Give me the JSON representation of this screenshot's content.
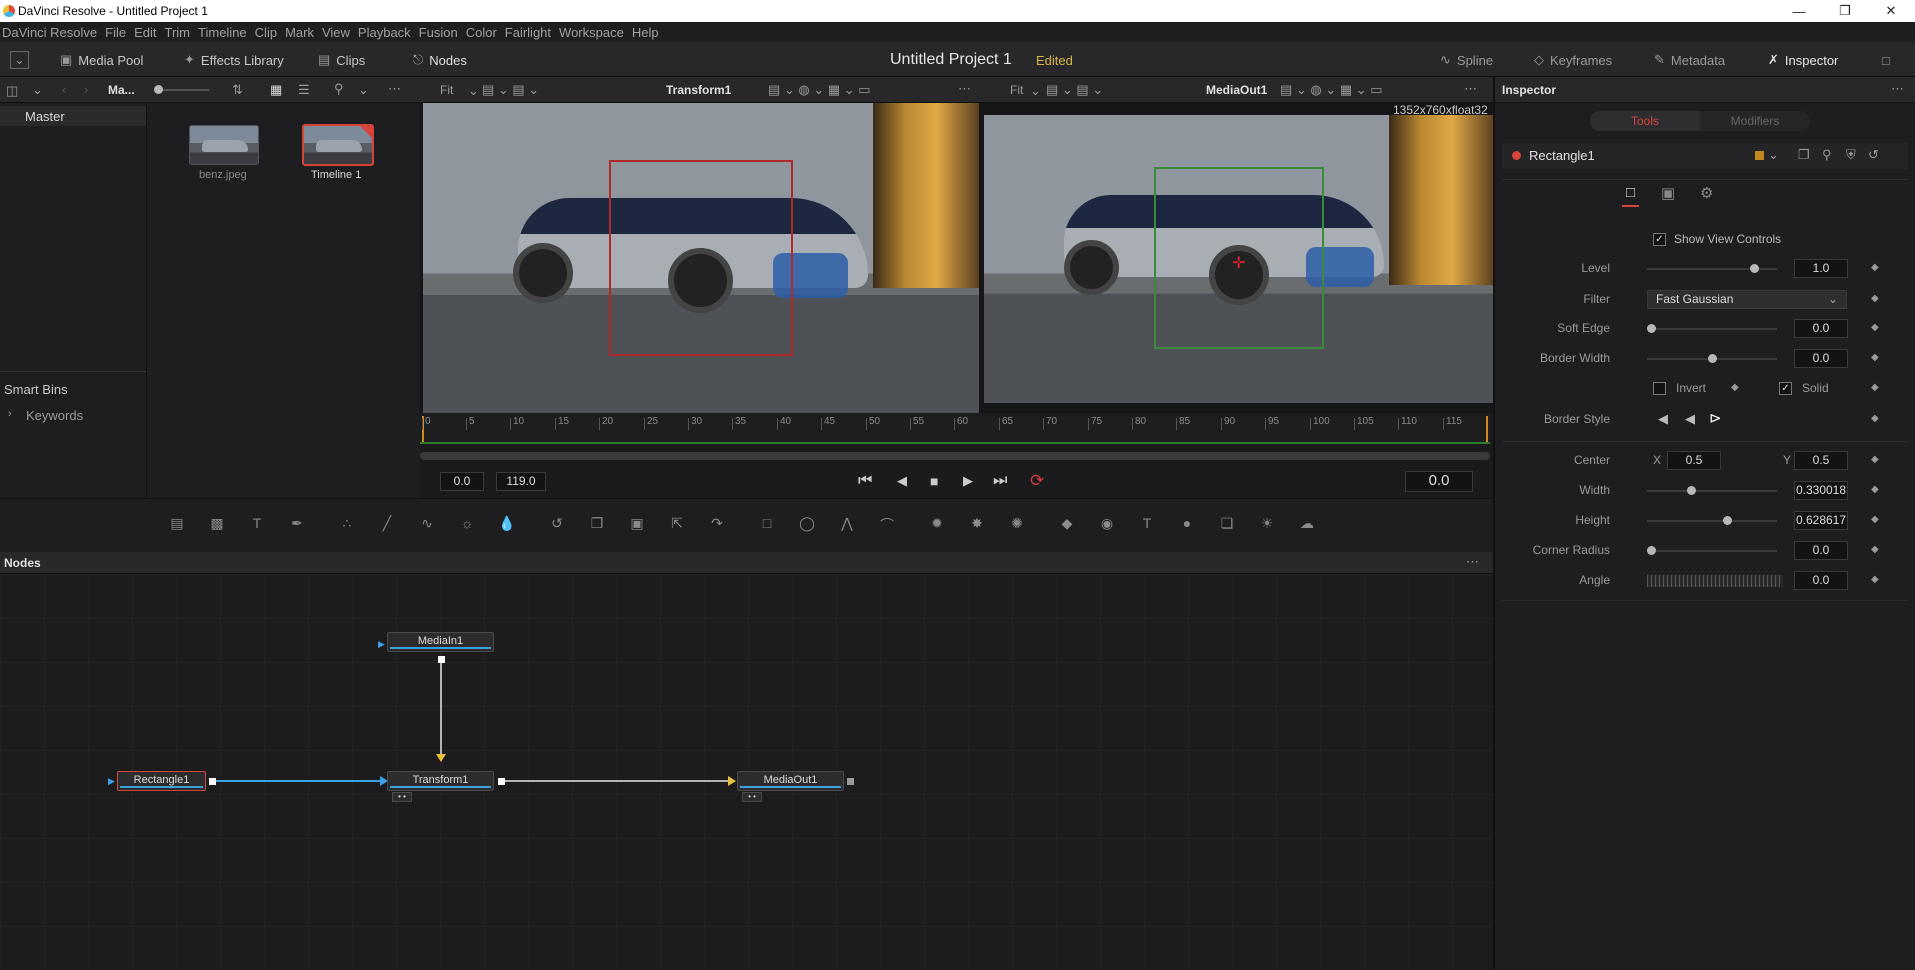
{
  "window": {
    "title": "DaVinci Resolve - Untitled Project 1"
  },
  "menu": [
    "DaVinci Resolve",
    "File",
    "Edit",
    "Trim",
    "Timeline",
    "Clip",
    "Mark",
    "View",
    "Playback",
    "Fusion",
    "Color",
    "Fairlight",
    "Workspace",
    "Help"
  ],
  "toolbar": {
    "media_pool": "Media Pool",
    "effects_library": "Effects Library",
    "clips": "Clips",
    "nodes": "Nodes",
    "project_title": "Untitled Project 1",
    "edited": "Edited",
    "spline": "Spline",
    "keyframes": "Keyframes",
    "metadata": "Metadata",
    "inspector": "Inspector"
  },
  "media_pool": {
    "bin_short": "Ma...",
    "master": "Master",
    "smart_bins": "Smart Bins",
    "keywords": "Keywords",
    "clips": [
      {
        "name": "benz.jpeg"
      },
      {
        "name": "Timeline 1"
      }
    ]
  },
  "viewer_left": {
    "fit": "Fit",
    "name": "Transform1"
  },
  "viewer_right": {
    "fit": "Fit",
    "name": "MediaOut1",
    "resolution": "1352x760xfloat32"
  },
  "ruler": {
    "ticks": [
      "0",
      "5",
      "10",
      "15",
      "20",
      "25",
      "30",
      "35",
      "40",
      "45",
      "50",
      "55",
      "60",
      "65",
      "70",
      "75",
      "80",
      "85",
      "90",
      "95",
      "100",
      "105",
      "110",
      "115"
    ]
  },
  "transport": {
    "start": "0.0",
    "end": "119.0",
    "current": "0.0"
  },
  "nodes_panel": {
    "title": "Nodes",
    "nodes": [
      {
        "name": "MediaIn1"
      },
      {
        "name": "Rectangle1"
      },
      {
        "name": "Transform1"
      },
      {
        "name": "MediaOut1"
      }
    ]
  },
  "inspector": {
    "title": "Inspector",
    "tab_tools": "Tools",
    "tab_modifiers": "Modifiers",
    "tool_name": "Rectangle1",
    "show_view_controls": "Show View Controls",
    "level_label": "Level",
    "level": "1.0",
    "level_pos": 0.85,
    "filter_label": "Filter",
    "filter": "Fast Gaussian",
    "soft_edge_label": "Soft Edge",
    "soft_edge": "0.0",
    "soft_edge_pos": 0.0,
    "border_width_label": "Border Width",
    "border_width": "0.0",
    "border_width_pos": 0.5,
    "invert_label": "Invert",
    "solid_label": "Solid",
    "border_style_label": "Border Style",
    "center_label": "Center",
    "center_x_label": "X",
    "center_x": "0.5",
    "center_y_label": "Y",
    "center_y": "0.5",
    "width_label": "Width",
    "width": "0.330018",
    "width_pos": 0.33,
    "height_label": "Height",
    "height": "0.628617",
    "height_pos": 0.63,
    "corner_radius_label": "Corner Radius",
    "corner_radius": "0.0",
    "corner_radius_pos": 0.0,
    "angle_label": "Angle",
    "angle": "0.0"
  }
}
